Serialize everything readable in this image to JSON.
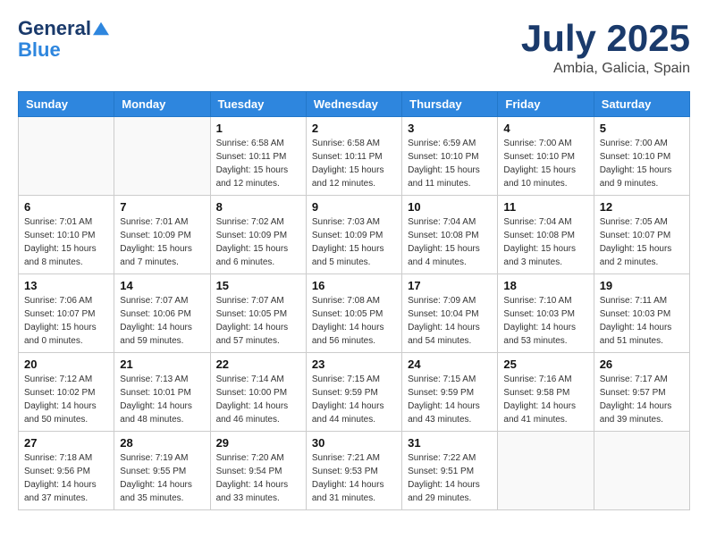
{
  "logo": {
    "line1": "General",
    "line2": "Blue"
  },
  "title": "July 2025",
  "location": "Ambia, Galicia, Spain",
  "weekdays": [
    "Sunday",
    "Monday",
    "Tuesday",
    "Wednesday",
    "Thursday",
    "Friday",
    "Saturday"
  ],
  "weeks": [
    [
      {
        "day": "",
        "detail": ""
      },
      {
        "day": "",
        "detail": ""
      },
      {
        "day": "1",
        "detail": "Sunrise: 6:58 AM\nSunset: 10:11 PM\nDaylight: 15 hours\nand 12 minutes."
      },
      {
        "day": "2",
        "detail": "Sunrise: 6:58 AM\nSunset: 10:11 PM\nDaylight: 15 hours\nand 12 minutes."
      },
      {
        "day": "3",
        "detail": "Sunrise: 6:59 AM\nSunset: 10:10 PM\nDaylight: 15 hours\nand 11 minutes."
      },
      {
        "day": "4",
        "detail": "Sunrise: 7:00 AM\nSunset: 10:10 PM\nDaylight: 15 hours\nand 10 minutes."
      },
      {
        "day": "5",
        "detail": "Sunrise: 7:00 AM\nSunset: 10:10 PM\nDaylight: 15 hours\nand 9 minutes."
      }
    ],
    [
      {
        "day": "6",
        "detail": "Sunrise: 7:01 AM\nSunset: 10:10 PM\nDaylight: 15 hours\nand 8 minutes."
      },
      {
        "day": "7",
        "detail": "Sunrise: 7:01 AM\nSunset: 10:09 PM\nDaylight: 15 hours\nand 7 minutes."
      },
      {
        "day": "8",
        "detail": "Sunrise: 7:02 AM\nSunset: 10:09 PM\nDaylight: 15 hours\nand 6 minutes."
      },
      {
        "day": "9",
        "detail": "Sunrise: 7:03 AM\nSunset: 10:09 PM\nDaylight: 15 hours\nand 5 minutes."
      },
      {
        "day": "10",
        "detail": "Sunrise: 7:04 AM\nSunset: 10:08 PM\nDaylight: 15 hours\nand 4 minutes."
      },
      {
        "day": "11",
        "detail": "Sunrise: 7:04 AM\nSunset: 10:08 PM\nDaylight: 15 hours\nand 3 minutes."
      },
      {
        "day": "12",
        "detail": "Sunrise: 7:05 AM\nSunset: 10:07 PM\nDaylight: 15 hours\nand 2 minutes."
      }
    ],
    [
      {
        "day": "13",
        "detail": "Sunrise: 7:06 AM\nSunset: 10:07 PM\nDaylight: 15 hours\nand 0 minutes."
      },
      {
        "day": "14",
        "detail": "Sunrise: 7:07 AM\nSunset: 10:06 PM\nDaylight: 14 hours\nand 59 minutes."
      },
      {
        "day": "15",
        "detail": "Sunrise: 7:07 AM\nSunset: 10:05 PM\nDaylight: 14 hours\nand 57 minutes."
      },
      {
        "day": "16",
        "detail": "Sunrise: 7:08 AM\nSunset: 10:05 PM\nDaylight: 14 hours\nand 56 minutes."
      },
      {
        "day": "17",
        "detail": "Sunrise: 7:09 AM\nSunset: 10:04 PM\nDaylight: 14 hours\nand 54 minutes."
      },
      {
        "day": "18",
        "detail": "Sunrise: 7:10 AM\nSunset: 10:03 PM\nDaylight: 14 hours\nand 53 minutes."
      },
      {
        "day": "19",
        "detail": "Sunrise: 7:11 AM\nSunset: 10:03 PM\nDaylight: 14 hours\nand 51 minutes."
      }
    ],
    [
      {
        "day": "20",
        "detail": "Sunrise: 7:12 AM\nSunset: 10:02 PM\nDaylight: 14 hours\nand 50 minutes."
      },
      {
        "day": "21",
        "detail": "Sunrise: 7:13 AM\nSunset: 10:01 PM\nDaylight: 14 hours\nand 48 minutes."
      },
      {
        "day": "22",
        "detail": "Sunrise: 7:14 AM\nSunset: 10:00 PM\nDaylight: 14 hours\nand 46 minutes."
      },
      {
        "day": "23",
        "detail": "Sunrise: 7:15 AM\nSunset: 9:59 PM\nDaylight: 14 hours\nand 44 minutes."
      },
      {
        "day": "24",
        "detail": "Sunrise: 7:15 AM\nSunset: 9:59 PM\nDaylight: 14 hours\nand 43 minutes."
      },
      {
        "day": "25",
        "detail": "Sunrise: 7:16 AM\nSunset: 9:58 PM\nDaylight: 14 hours\nand 41 minutes."
      },
      {
        "day": "26",
        "detail": "Sunrise: 7:17 AM\nSunset: 9:57 PM\nDaylight: 14 hours\nand 39 minutes."
      }
    ],
    [
      {
        "day": "27",
        "detail": "Sunrise: 7:18 AM\nSunset: 9:56 PM\nDaylight: 14 hours\nand 37 minutes."
      },
      {
        "day": "28",
        "detail": "Sunrise: 7:19 AM\nSunset: 9:55 PM\nDaylight: 14 hours\nand 35 minutes."
      },
      {
        "day": "29",
        "detail": "Sunrise: 7:20 AM\nSunset: 9:54 PM\nDaylight: 14 hours\nand 33 minutes."
      },
      {
        "day": "30",
        "detail": "Sunrise: 7:21 AM\nSunset: 9:53 PM\nDaylight: 14 hours\nand 31 minutes."
      },
      {
        "day": "31",
        "detail": "Sunrise: 7:22 AM\nSunset: 9:51 PM\nDaylight: 14 hours\nand 29 minutes."
      },
      {
        "day": "",
        "detail": ""
      },
      {
        "day": "",
        "detail": ""
      }
    ]
  ]
}
